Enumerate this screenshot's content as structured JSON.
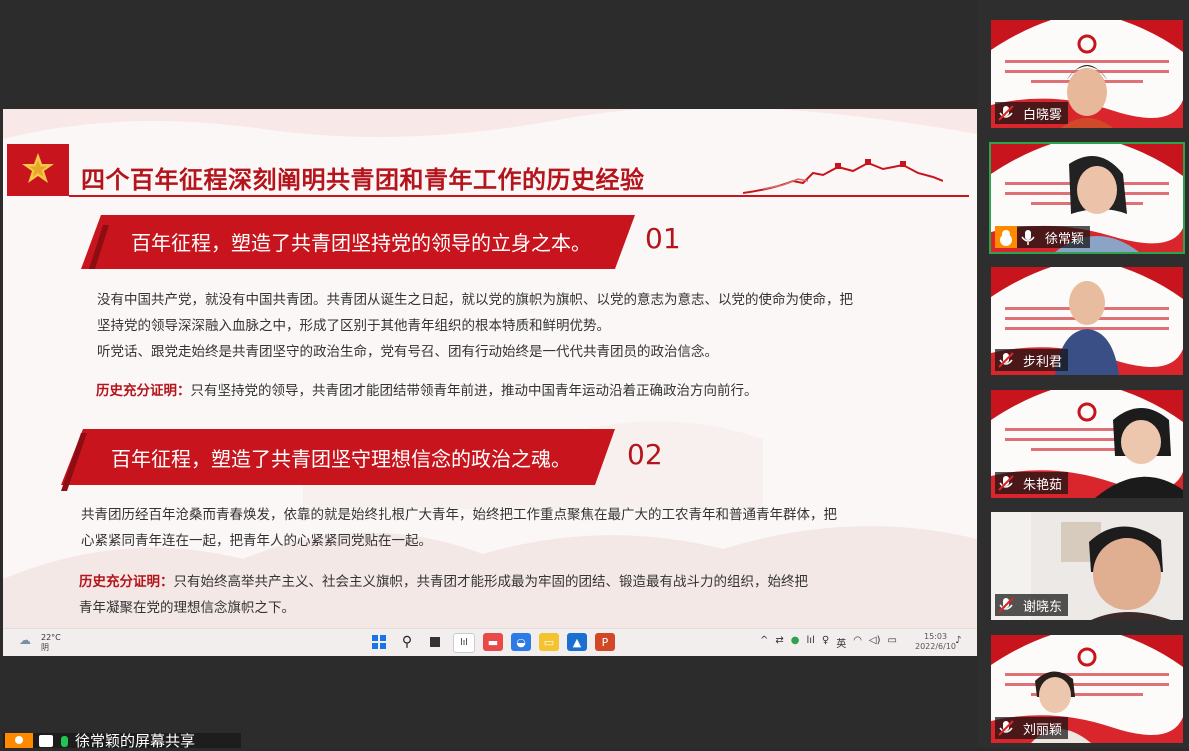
{
  "slide": {
    "title": "四个百年征程深刻阐明共青团和青年工作的历史经验",
    "sections": [
      {
        "heading": "百年征程，塑造了共青团坚持党的领导的立身之本。",
        "number": "01",
        "lines": [
          "没有中国共产党，就没有中国共青团。共青团从诞生之日起，就以党的旗帜为旗帜、以党的意志为意志、以党的使命为使命，把",
          "坚持党的领导深深融入血脉之中，形成了区别于其他青年组织的根本特质和鲜明优势。",
          "听党话、跟党走始终是共青团坚守的政治生命，党有号召、团有行动始终是一代代共青团员的政治信念。"
        ],
        "evidence_label": "历史充分证明：",
        "evidence_lines": [
          "只有坚持党的领导，共青团才能团结带领青年前进，推动中国青年运动沿着正确政治方向前行。"
        ]
      },
      {
        "heading": "百年征程，塑造了共青团坚守理想信念的政治之魂。",
        "number": "02",
        "lines": [
          "共青团历经百年沧桑而青春焕发，依靠的就是始终扎根广大青年，始终把工作重点聚焦在最广大的工农青年和普通青年群体，把",
          "心紧紧同青年连在一起，把青年人的心紧紧同党贴在一起。"
        ],
        "evidence_label": "历史充分证明：",
        "evidence_lines": [
          "只有始终高举共产主义、社会主义旗帜，共青团才能形成最为牢固的团结、锻造最有战斗力的组织，始终把",
          "青年凝聚在党的理想信念旗帜之下。"
        ]
      }
    ]
  },
  "taskbar": {
    "weather_temp": "22°C",
    "weather_desc": "阴",
    "lang": "英",
    "time": "15:03",
    "date": "2022/6/10"
  },
  "share_label": "徐常颖的屏幕共享",
  "participants": [
    {
      "name": "白晓雾",
      "mic": "muted",
      "active": false
    },
    {
      "name": "徐常颖",
      "mic": "on",
      "active": true,
      "host": true
    },
    {
      "name": "步利君",
      "mic": "muted",
      "active": false
    },
    {
      "name": "朱艳茹",
      "mic": "muted",
      "active": false
    },
    {
      "name": "谢晓东",
      "mic": "muted",
      "active": false
    },
    {
      "name": "刘丽颖",
      "mic": "muted",
      "active": false
    }
  ],
  "colors": {
    "accent_red": "#c8151d",
    "text_red": "#b4141b",
    "active_border": "#2ea24c",
    "host_orange": "#ff8a00"
  }
}
